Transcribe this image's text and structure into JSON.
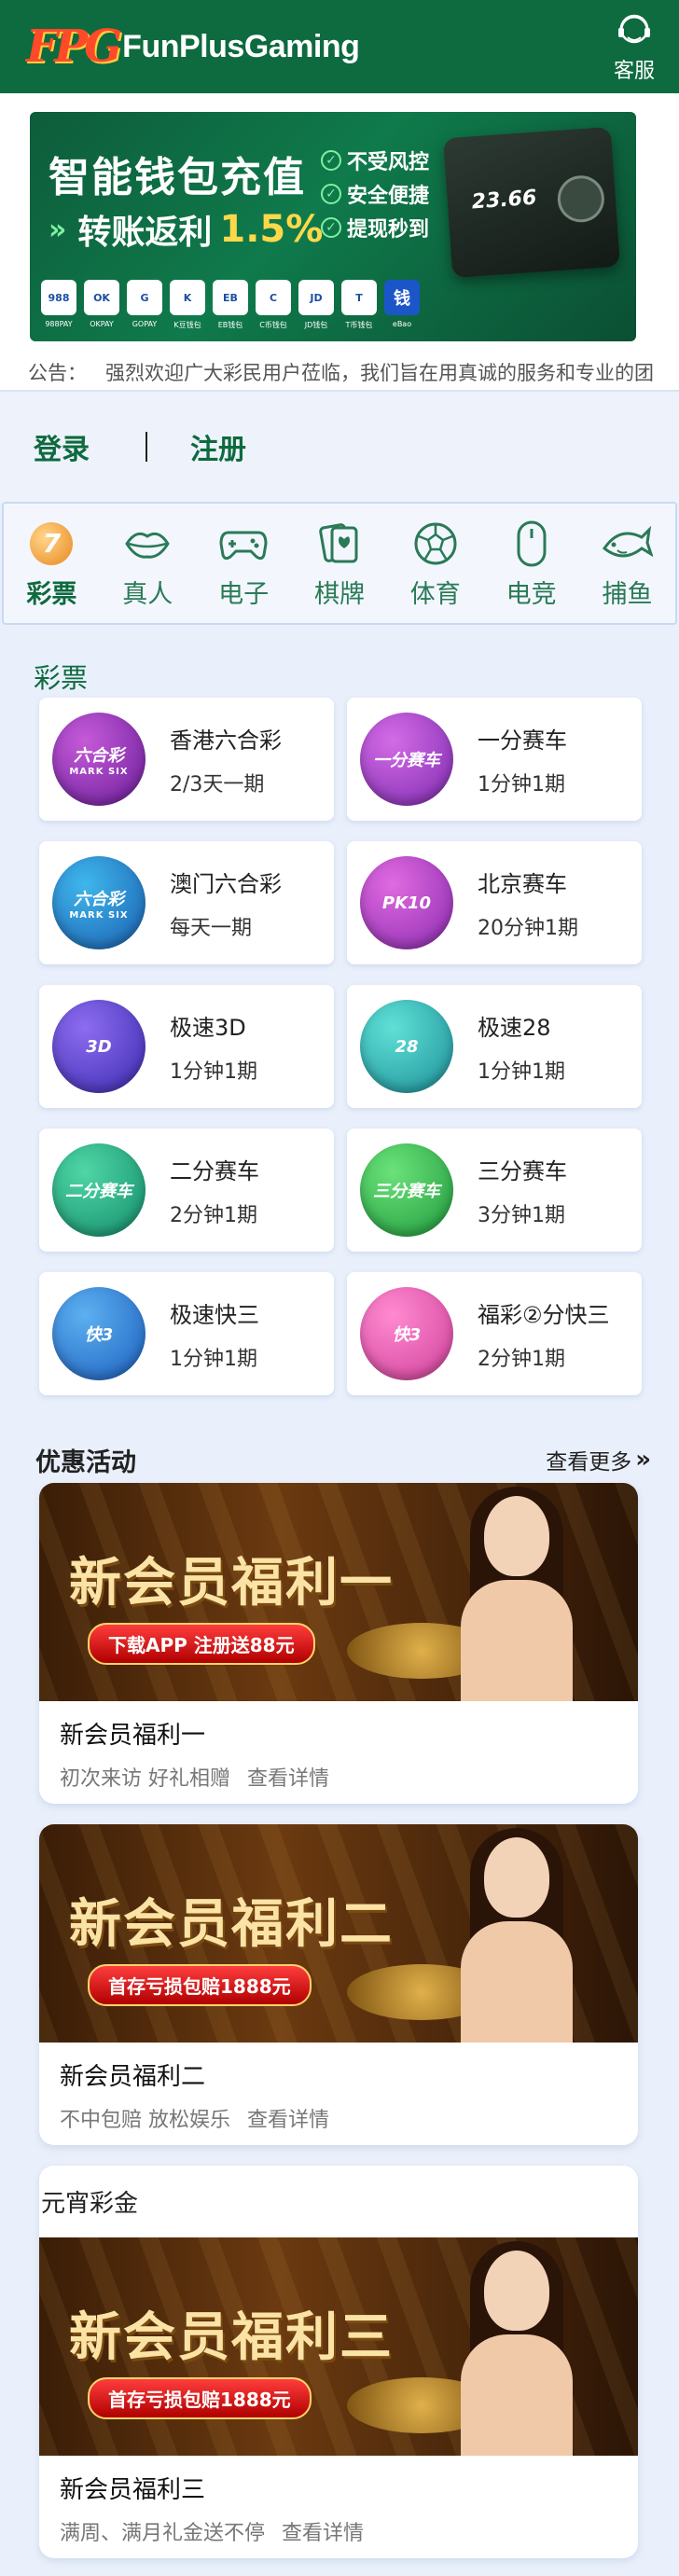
{
  "header": {
    "logo_mark": "FPG",
    "logo_text": "FunPlusGaming",
    "service_label": "客服"
  },
  "banner": {
    "title": "智能钱包充值",
    "subtitle_prefix": "转账返利",
    "subtitle_pct": "1.5%",
    "checks": [
      "不受风控",
      "安全便捷",
      "提现秒到"
    ],
    "wallet_amount": "23.66",
    "pay_methods": [
      "988",
      "OK",
      "G",
      "K",
      "EB",
      "C",
      "JD",
      "T",
      "钱"
    ],
    "pay_labels": [
      "988PAY",
      "OKPAY",
      "GOPAY",
      "K豆钱包",
      "EB钱包",
      "C币钱包",
      "JD钱包",
      "T币钱包",
      "eBao"
    ]
  },
  "notice": {
    "label": "公告：",
    "text": "强烈欢迎广大彩民用户莅临，我们旨在用真诚的服务和专业的团"
  },
  "auth": {
    "login": "登录",
    "register": "注册"
  },
  "nav": [
    {
      "label": "彩票",
      "icon": "lottery-icon",
      "active": true
    },
    {
      "label": "真人",
      "icon": "lips-icon"
    },
    {
      "label": "电子",
      "icon": "gamepad-icon"
    },
    {
      "label": "棋牌",
      "icon": "cards-icon"
    },
    {
      "label": "体育",
      "icon": "soccer-icon"
    },
    {
      "label": "电竞",
      "icon": "mouse-icon"
    },
    {
      "label": "捕鱼",
      "icon": "fish-icon"
    }
  ],
  "lottery_section": {
    "title": "彩票",
    "items": [
      {
        "name": "香港六合彩",
        "period": "2/3天一期",
        "badge": "六合彩",
        "badge_sub": "MARK SIX",
        "color_a": "#c55ad8",
        "color_b": "#6a1d9a"
      },
      {
        "name": "一分赛车",
        "period": "1分钟1期",
        "badge": "一分赛车",
        "badge_sub": "",
        "color_a": "#d46be6",
        "color_b": "#7d2bb0"
      },
      {
        "name": "澳门六合彩",
        "period": "每天一期",
        "badge": "六合彩",
        "badge_sub": "MARK SIX",
        "color_a": "#3fb6ec",
        "color_b": "#1a5fb0"
      },
      {
        "name": "北京赛车",
        "period": "20分钟1期",
        "badge": "PK10",
        "badge_sub": "",
        "color_a": "#e06ae0",
        "color_b": "#8a2bb0"
      },
      {
        "name": "极速3D",
        "period": "1分钟1期",
        "badge": "3D",
        "badge_sub": "",
        "color_a": "#8d6cf0",
        "color_b": "#3b2bb0"
      },
      {
        "name": "极速28",
        "period": "1分钟1期",
        "badge": "28",
        "badge_sub": "",
        "color_a": "#5fe0d6",
        "color_b": "#1c8f98"
      },
      {
        "name": "二分赛车",
        "period": "2分钟1期",
        "badge": "二分赛车",
        "badge_sub": "",
        "color_a": "#4fd6a6",
        "color_b": "#138c6a"
      },
      {
        "name": "三分赛车",
        "period": "3分钟1期",
        "badge": "三分赛车",
        "badge_sub": "",
        "color_a": "#6be27a",
        "color_b": "#1f9a3c"
      },
      {
        "name": "极速快三",
        "period": "1分钟1期",
        "badge": "快3",
        "badge_sub": "",
        "color_a": "#5cb0f0",
        "color_b": "#1c5fc0"
      },
      {
        "name": "福彩②分快三",
        "period": "2分钟1期",
        "badge": "快3",
        "badge_sub": "",
        "color_a": "#ff8ad0",
        "color_b": "#d03f9a"
      }
    ]
  },
  "promotions": {
    "title": "优惠活动",
    "more": "查看更多",
    "items": [
      {
        "image_title": "新会员福利一",
        "image_pill": "下载APP 注册送88元",
        "name": "新会员福利一",
        "desc": "初次来访 好礼相赠",
        "detail": "查看详情"
      },
      {
        "image_title": "新会员福利二",
        "image_pill": "首存亏损包赔1888元",
        "name": "新会员福利二",
        "desc": "不中包赔 放松娱乐",
        "detail": "查看详情"
      },
      {
        "label": "元宵彩金",
        "image_title": "新会员福利三",
        "image_pill": "首存亏损包赔1888元",
        "name": "新会员福利三",
        "desc": "满周、满月礼金送不停",
        "detail": "查看详情"
      }
    ]
  }
}
